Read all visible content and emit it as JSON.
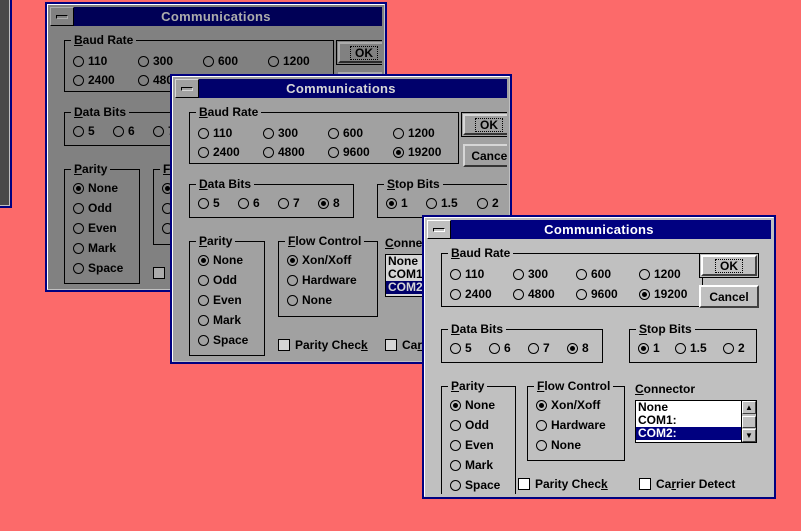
{
  "desktop": {
    "background_color": "#fc6a6a"
  },
  "dialog": {
    "title": "Communications",
    "minimize_icon": "minimize-icon",
    "buttons": {
      "ok": "OK",
      "cancel": "Cancel"
    },
    "baud_rate": {
      "legend_pre": "B",
      "legend_post": "aud Rate",
      "options": [
        "110",
        "300",
        "600",
        "1200",
        "2400",
        "4800",
        "9600",
        "19200"
      ],
      "selected": "19200"
    },
    "data_bits": {
      "legend_pre": "D",
      "legend_post": "ata Bits",
      "options": [
        "5",
        "6",
        "7",
        "8"
      ],
      "selected": "8"
    },
    "stop_bits": {
      "legend_pre": "S",
      "legend_post": "top Bits",
      "options": [
        "1",
        "1.5",
        "2"
      ],
      "selected": "1"
    },
    "parity": {
      "legend_pre": "P",
      "legend_post": "arity",
      "options": [
        "None",
        "Odd",
        "Even",
        "Mark",
        "Space"
      ],
      "selected": "None"
    },
    "flow_control": {
      "legend_pre": "F",
      "legend_post": "low Control",
      "options": [
        "Xon/Xoff",
        "Hardware",
        "None"
      ],
      "selected": "Xon/Xoff"
    },
    "connector": {
      "label_pre": "C",
      "label_post": "onnector",
      "items": [
        "None",
        "COM1:",
        "COM2:"
      ],
      "selected": "COM2:",
      "scroll_up_glyph": "▲",
      "scroll_down_glyph": "▼"
    },
    "checkboxes": {
      "parity_check": {
        "pre": "Parity Chec",
        "key": "k",
        "post": "",
        "checked": false
      },
      "carrier_detect": {
        "pre": "Ca",
        "key": "r",
        "post": "rier Detect",
        "checked": false
      }
    }
  },
  "windows": [
    {
      "name": "communications-window-1",
      "z": 1,
      "state": "background-dimmed"
    },
    {
      "name": "communications-window-2",
      "z": 2,
      "state": "background-dimmed"
    },
    {
      "name": "communications-window-3",
      "z": 3,
      "state": "background-dimmed"
    },
    {
      "name": "communications-window-4",
      "z": 4,
      "state": "active"
    }
  ],
  "colors": {
    "title_active": "#000080",
    "face": "#c0c0c0",
    "highlight": "#ffffff",
    "shadow": "#404040",
    "selection": "#000080"
  }
}
